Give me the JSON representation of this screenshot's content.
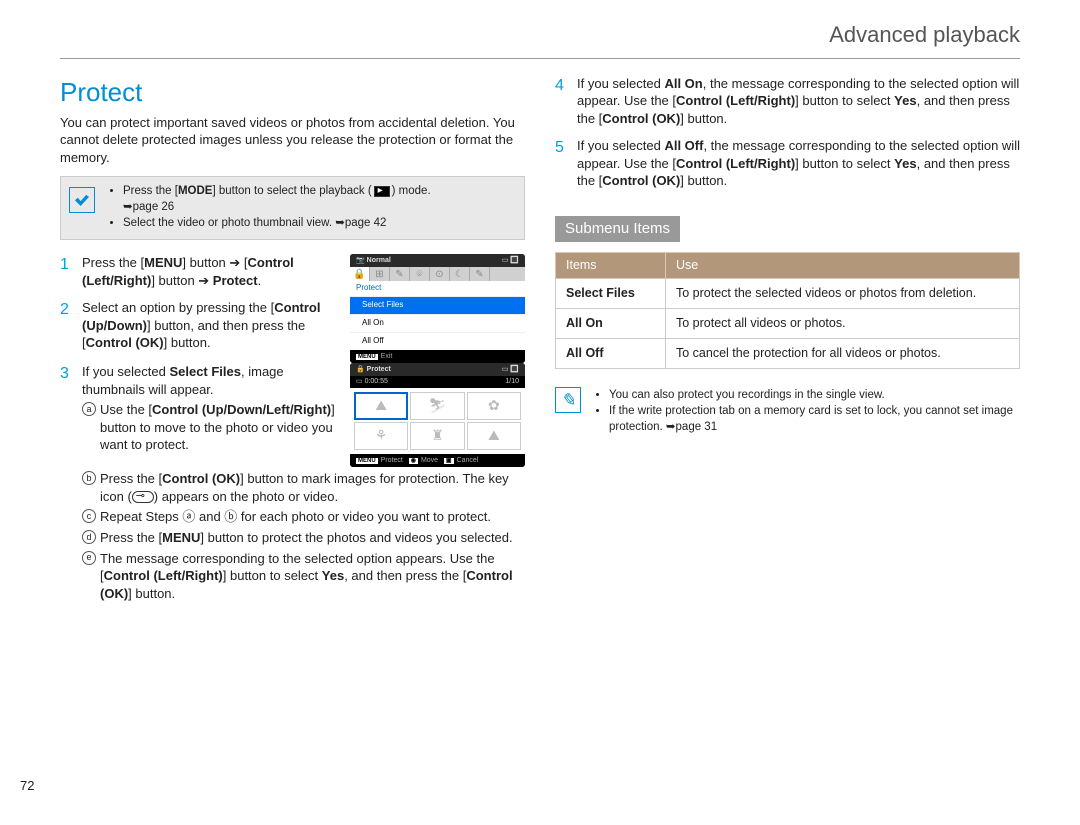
{
  "header": "Advanced playback",
  "title": "Protect",
  "intro": "You can protect important saved videos or photos from accidental deletion. You cannot delete protected images unless you release the protection or format the memory.",
  "note1": {
    "items": [
      {
        "pre": "Press the [",
        "bold": "MODE",
        "post": "] button to select the playback (",
        "post2": ") mode.",
        "ref": "➥page 26"
      },
      {
        "text": "Select the video or photo thumbnail view. ➥page 42"
      }
    ]
  },
  "screenshot1": {
    "topLeft": "Normal",
    "section": "Protect",
    "items": [
      "Select Files",
      "All On",
      "All Off"
    ],
    "exit": "Exit",
    "exitTag": "MENU"
  },
  "screenshot2": {
    "label": "Protect",
    "time": "0:00:55",
    "count": "1/10",
    "footer": [
      "Protect",
      "Move",
      "Cancel"
    ],
    "footerTag": "MENU"
  },
  "steps": [
    {
      "num": "1",
      "parts": [
        "Press the [",
        "MENU",
        "] button ➔ [",
        "Control (Left/Right)",
        "] button ➔ ",
        "Protect",
        "."
      ]
    },
    {
      "num": "2",
      "parts": [
        "Select an option by pressing the [",
        "Control (Up/Down)",
        "] button, and then press the [",
        "Control (OK)",
        "] button."
      ]
    },
    {
      "num": "3",
      "parts": [
        "If you selected ",
        "Select Files",
        ", image thumbnails will appear."
      ],
      "subs": [
        {
          "m": "a",
          "parts": [
            "Use the [",
            "Control (Up/Down/Left/Right)",
            "] button to move to the photo or video you want to protect."
          ]
        },
        {
          "m": "b",
          "parts": [
            "Press the [",
            "Control (OK)",
            "] button to mark images for protection. The key icon (",
            " ",
            ") appears on the photo or video."
          ]
        },
        {
          "m": "c",
          "parts": [
            "Repeat Steps ⓐ and ⓑ for each photo or video you want to protect."
          ]
        },
        {
          "m": "d",
          "parts": [
            "Press the [",
            "MENU",
            "] button to protect the photos and videos you selected."
          ]
        },
        {
          "m": "e",
          "parts": [
            "The message corresponding to the selected option appears. Use the [",
            "Control (Left/Right)",
            "] button to select ",
            "Yes",
            ", and then press the [",
            "Control (OK)",
            "] button."
          ]
        }
      ]
    },
    {
      "num": "4",
      "parts": [
        "If you selected ",
        "All On",
        ", the message corresponding to the selected option will appear. Use the [",
        "Control (Left/Right)",
        "] button to select ",
        "Yes",
        ", and then press the [",
        "Control (OK)",
        "] button."
      ]
    },
    {
      "num": "5",
      "parts": [
        "If you selected ",
        "All Off",
        ", the message corresponding to the selected option will appear. Use the [",
        "Control (Left/Right)",
        "] button to select ",
        "Yes",
        ", and then press the [",
        "Control (OK)",
        "] button."
      ]
    }
  ],
  "subhead": "Submenu Items",
  "table": {
    "headers": [
      "Items",
      "Use"
    ],
    "rows": [
      [
        "Select Files",
        "To protect the selected videos or photos from deletion."
      ],
      [
        "All On",
        "To protect all videos or photos."
      ],
      [
        "All Off",
        "To cancel the protection for all videos or photos."
      ]
    ]
  },
  "note2": {
    "items": [
      "You can also protect you recordings in the single view.",
      "If the write protection tab on a memory card is set to lock, you cannot set image protection. ➥page 31"
    ]
  },
  "pagenum": "72"
}
